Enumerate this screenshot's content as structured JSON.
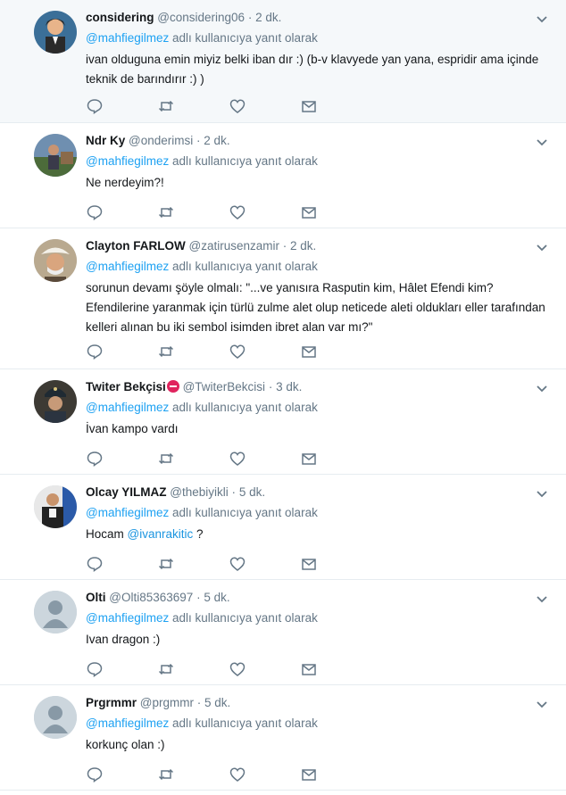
{
  "colors": {
    "accent": "#1da1f2",
    "muted": "#657786",
    "text": "#14171a",
    "border": "#e6ecf0",
    "highlight_bg": "#f5f8fa"
  },
  "icons": {
    "reply": "reply-icon",
    "retweet": "retweet-icon",
    "like": "heart-icon",
    "dm": "envelope-icon",
    "menu": "chevron-down-icon"
  },
  "tweets": [
    {
      "name": "considering",
      "handle": "@considering06",
      "dot": "·",
      "time": "2 dk.",
      "reply_to": "@mahfiegilmez",
      "reply_suffix": " adlı kullanıcıya yanıt olarak",
      "text": "ivan olduguna emin miyiz belki iban dır :)  (b-v klavyede yan yana, espridir ama içinde teknik de barındırır :) )"
    },
    {
      "name": "Ndr Ky",
      "handle": "@onderimsi",
      "dot": "·",
      "time": "2 dk.",
      "reply_to": "@mahfiegilmez",
      "reply_suffix": " adlı kullanıcıya yanıt olarak",
      "text": "Ne nerdeyim?!"
    },
    {
      "name": "Clayton FARLOW",
      "handle": "@zatirusenzamir",
      "dot": "·",
      "time": "2 dk.",
      "reply_to": "@mahfiegilmez",
      "reply_suffix": " adlı kullanıcıya yanıt olarak",
      "text": "sorunun devamı şöyle olmalı: \"...ve yanısıra Rasputin kim, Hâlet Efendi kim? Efendilerine yaranmak için türlü zulme alet olup neticede aleti oldukları eller tarafından kelleri alınan bu iki sembol isimden ibret alan var mı?\""
    },
    {
      "name": "Twiter Bekçisi",
      "handle": "@TwiterBekcisi",
      "dot": "·",
      "time": "3 dk.",
      "reply_to": "@mahfiegilmez",
      "reply_suffix": " adlı kullanıcıya yanıt olarak",
      "text": "İvan kampo vardı"
    },
    {
      "name": "Olcay YILMAZ",
      "handle": "@thebiyikli",
      "dot": "·",
      "time": "5 dk.",
      "reply_to": "@mahfiegilmez",
      "reply_suffix": " adlı kullanıcıya yanıt olarak",
      "text_prefix": "Hocam ",
      "text_mention": "@ivanrakitic",
      "text_suffix": " ?"
    },
    {
      "name": "Olti",
      "handle": "@Olti85363697",
      "dot": "·",
      "time": "5 dk.",
      "reply_to": "@mahfiegilmez",
      "reply_suffix": " adlı kullanıcıya yanıt olarak",
      "text": "Ivan dragon :)"
    },
    {
      "name": "Prgrmmr",
      "handle": "@prgmmr",
      "dot": "·",
      "time": "5 dk.",
      "reply_to": "@mahfiegilmez",
      "reply_suffix": " adlı kullanıcıya yanıt olarak",
      "text": "korkunç olan :)"
    }
  ]
}
